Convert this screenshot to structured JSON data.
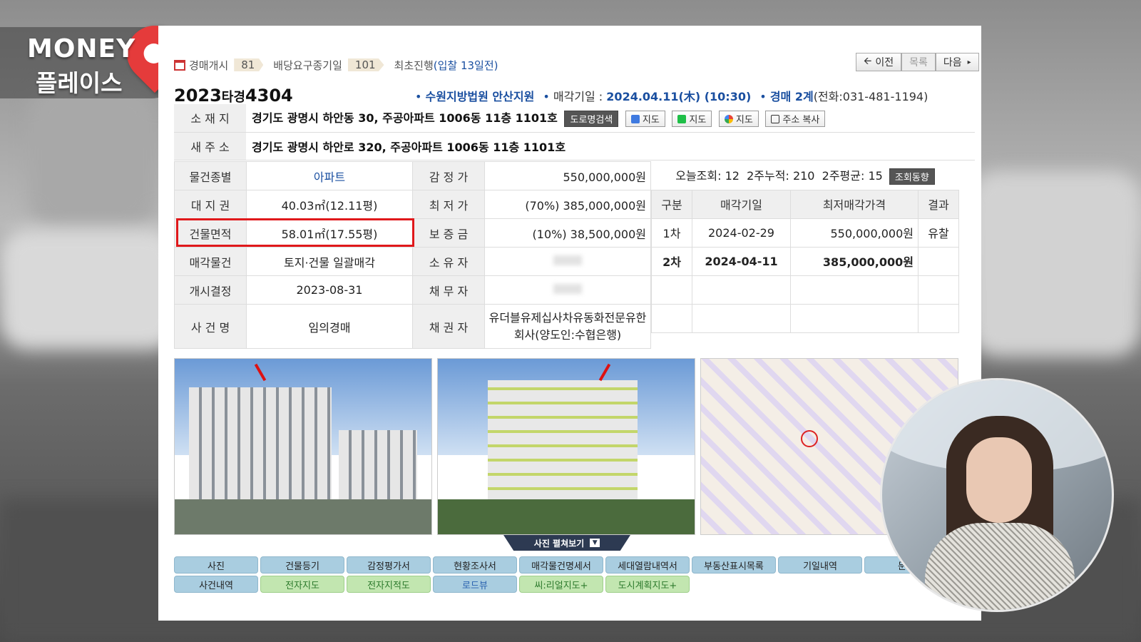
{
  "logo": {
    "line1": "MONEY",
    "line2": "플레이스"
  },
  "topbar": {
    "item1_label": "경매개시",
    "item1_count": "81",
    "item2_label": "배당요구종기일",
    "item2_count": "101",
    "item3_label": "최초진행",
    "item3_note": "(입찰 13일전)"
  },
  "nav": {
    "prev": "이전",
    "list": "목록",
    "next": "다음"
  },
  "case": {
    "year": "2023",
    "type": "타경",
    "number": "4304",
    "court": "수원지방법원 안산지원",
    "sale_label": "매각기일 :",
    "sale_date": "2024.04.11(木) (10:30)",
    "dept": "경매 2계",
    "phone": "(전화:031-481-1194)"
  },
  "address": {
    "label": "소 재 지",
    "value": "경기도 광명시 하안동 30, 주공아파트 1006동 11층 1101호",
    "btn_road": "도로명검색",
    "btn_daum": "지도",
    "btn_naver": "지도",
    "btn_google": "지도",
    "btn_copy": "주소 복사"
  },
  "new_address": {
    "label": "새 주 소",
    "value": "경기도 광명시 하안로 320, 주공아파트 1006동 11층 1101호"
  },
  "details": [
    {
      "l1": "물건종별",
      "v1": "아파트",
      "l2": "감 정 가",
      "v2": "550,000,000원"
    },
    {
      "l1": "대 지 권",
      "v1": "40.03㎡(12.11평)",
      "l2": "최 저 가",
      "v2": "(70%) 385,000,000원"
    },
    {
      "l1": "건물면적",
      "v1": "58.01㎡(17.55평)",
      "l2": "보 증 금",
      "v2": "(10%) 38,500,000원"
    },
    {
      "l1": "매각물건",
      "v1": "토지·건물 일괄매각",
      "l2": "소 유 자",
      "v2": ""
    },
    {
      "l1": "개시결정",
      "v1": "2023-08-31",
      "l2": "채 무 자",
      "v2": ""
    },
    {
      "l1": "사 건 명",
      "v1": "임의경매",
      "l2": "채 권 자",
      "v2": "유더블유제십사차유동화전문유한회사(양도인:수협은행)"
    }
  ],
  "stats": {
    "text": "오늘조회: 12  2주누적: 210  2주평균: 15",
    "btn": "조회동향"
  },
  "history": {
    "headers": [
      "구분",
      "매각기일",
      "최저매각가격",
      "결과"
    ],
    "rows": [
      {
        "round": "1차",
        "date": "2024-02-29",
        "price": "550,000,000원",
        "result": "유찰"
      },
      {
        "round": "2차",
        "date": "2024-04-11",
        "price": "385,000,000원",
        "result": ""
      }
    ]
  },
  "photos": {
    "expand_label": "사진 펼쳐보기"
  },
  "tabs_row1": [
    "사진",
    "건물등기",
    "감정평가서",
    "현황조사서",
    "매각물건명세서",
    "세대열람내역서",
    "부동산표시목록",
    "기일내역",
    "문건"
  ],
  "tabs_row2": [
    "사건내역",
    "전자지도",
    "전자지적도",
    "로드뷰",
    "씨:리얼지도+",
    "도시계획지도+"
  ],
  "colors": {
    "accent": "#1a4fa0",
    "highlight": "#e0181b",
    "tab_blue": "#a9cde0",
    "tab_green": "#c2e6b0"
  }
}
